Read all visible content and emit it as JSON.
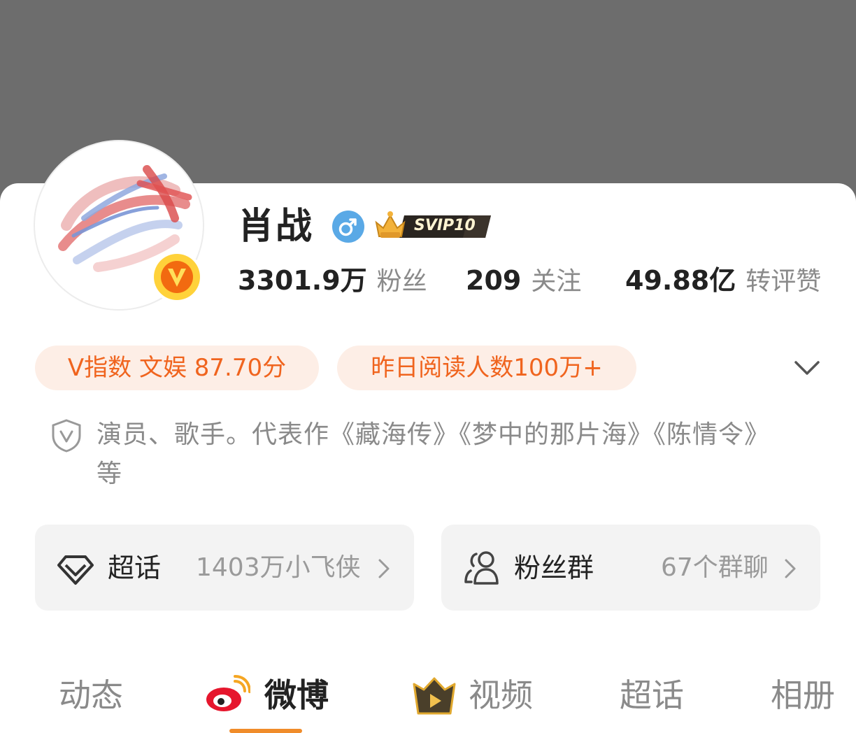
{
  "profile": {
    "name": "肖战",
    "svip_label": "SVIP10"
  },
  "stats": [
    {
      "value": "3301.9万",
      "label": "粉丝"
    },
    {
      "value": "209",
      "label": "关注"
    },
    {
      "value": "49.88亿",
      "label": "转评赞"
    }
  ],
  "tags": {
    "v_index": "V指数 文娱 87.70分",
    "reads": "昨日阅读人数100万+"
  },
  "bio": "演员、歌手。代表作《藏海传》《梦中的那片海》《陈情令》等",
  "entries": {
    "supertopic": {
      "title": "超话",
      "subtitle": "1403万小飞侠"
    },
    "fan_group": {
      "title": "粉丝群",
      "subtitle": "67个群聊"
    }
  },
  "tabs": [
    "动态",
    "微博",
    "视频",
    "超话",
    "相册"
  ],
  "active_tab": "微博",
  "colors": {
    "accent": "#f0641e",
    "tag_background": "#fdeee6",
    "tab_underline": "#f08c2a",
    "verified_blue": "#5aa9e6",
    "cover_gray": "#6d6d6d"
  },
  "icons": [
    "gender-male-icon",
    "svip-crown-icon",
    "orange-v-verified-icon",
    "chevron-down-icon",
    "shield-v-icon",
    "diamond-icon",
    "people-icon",
    "chevron-right-icon",
    "weibo-logo-icon",
    "video-icon"
  ]
}
